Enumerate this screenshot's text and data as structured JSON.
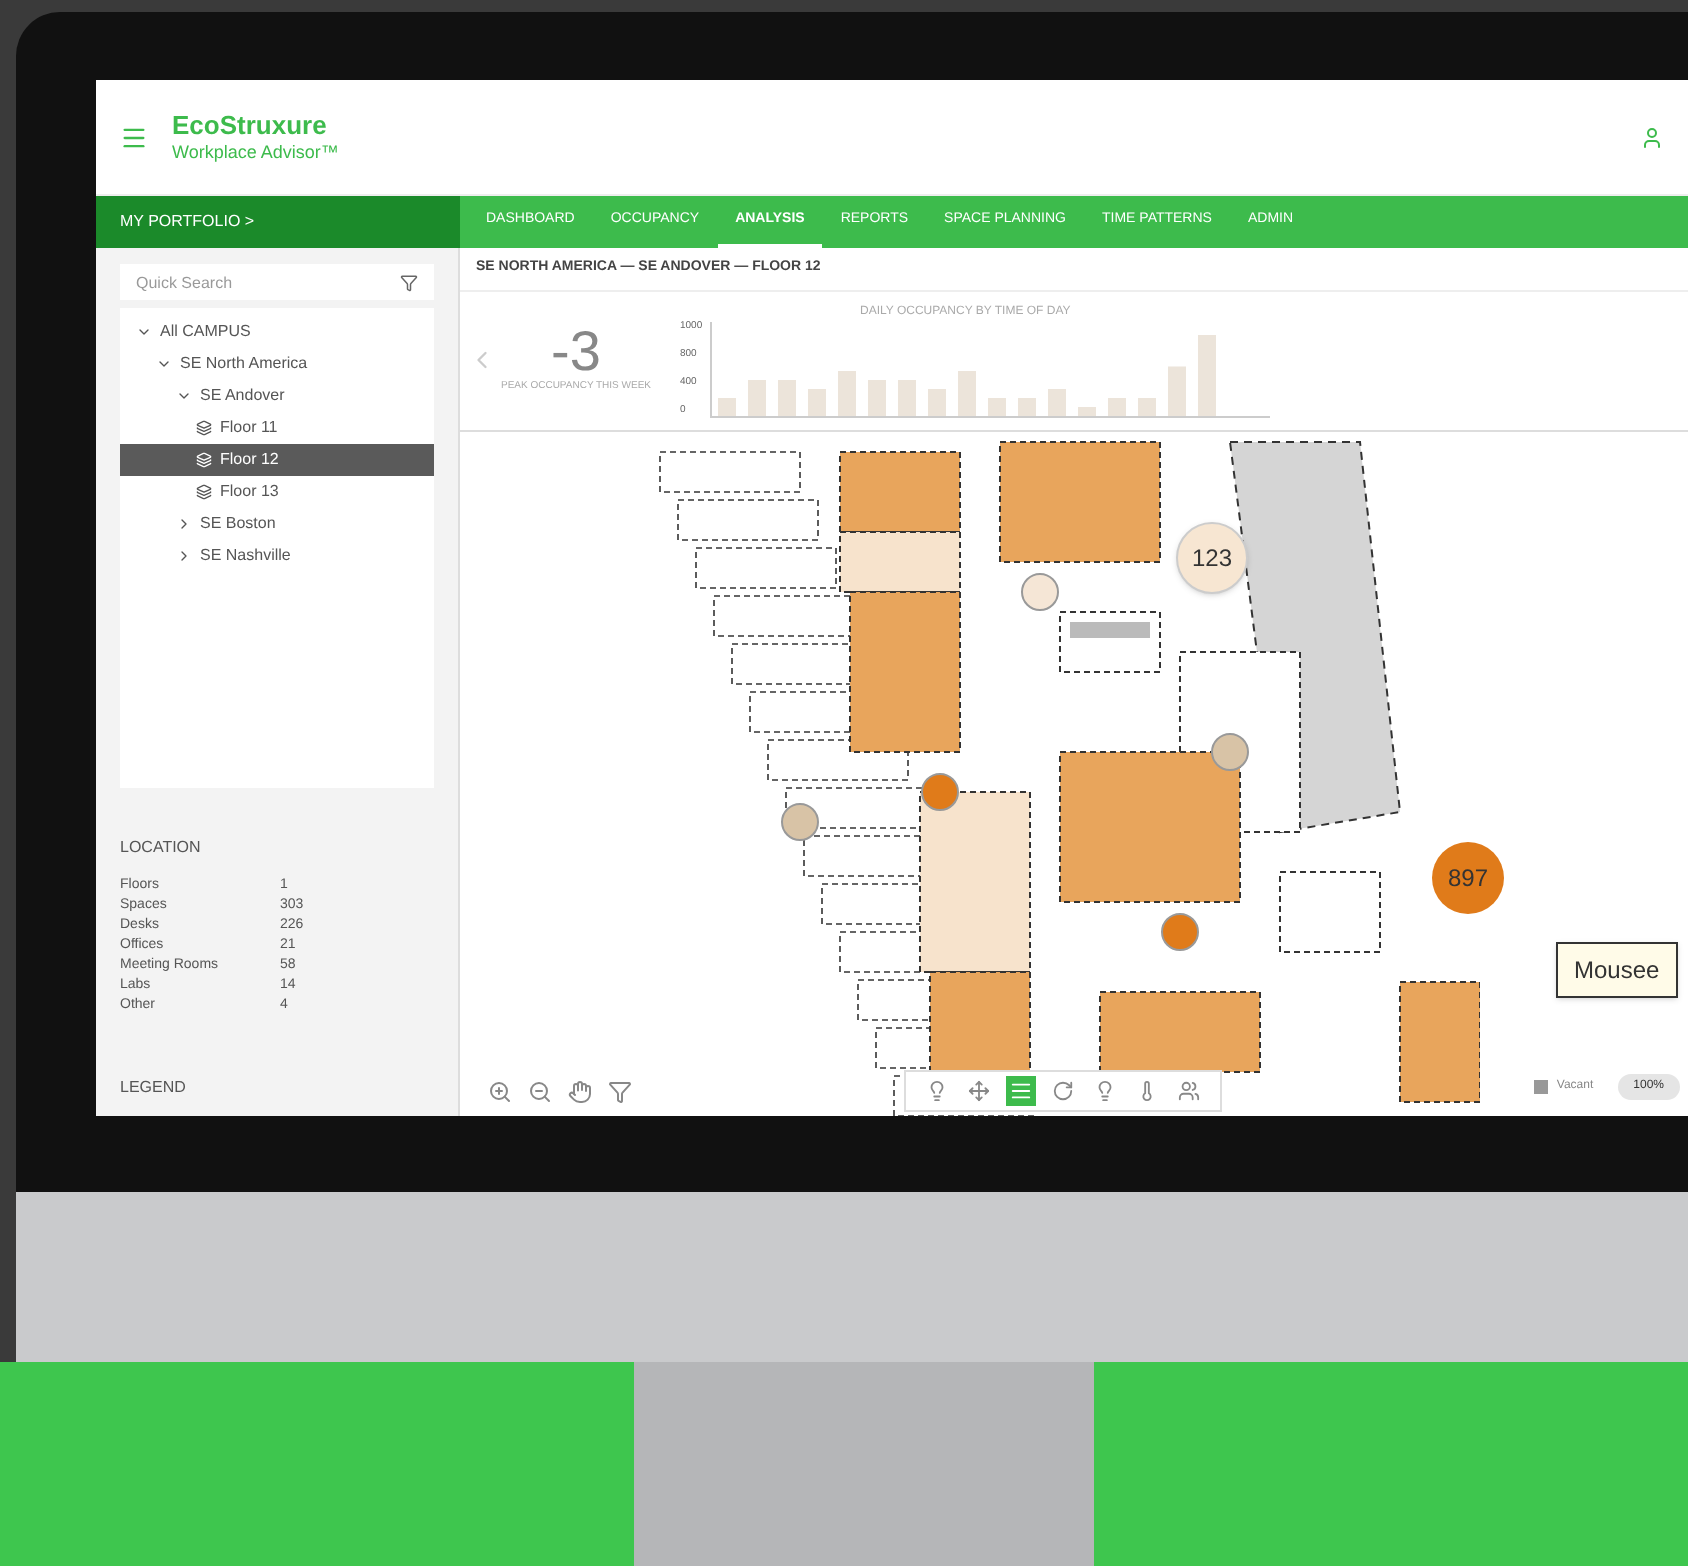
{
  "header": {
    "brand": "EcoStruxure",
    "product": "Workplace Advisor™"
  },
  "portfolio": {
    "label": "MY PORTFOLIO >"
  },
  "tabs": [
    {
      "label": "DASHBOARD",
      "selected": false
    },
    {
      "label": "OCCUPANCY",
      "selected": false
    },
    {
      "label": "ANALYSIS",
      "selected": true
    },
    {
      "label": "REPORTS",
      "selected": false
    },
    {
      "label": "SPACE PLANNING",
      "selected": false
    },
    {
      "label": "TIME PATTERNS",
      "selected": false
    },
    {
      "label": "ADMIN",
      "selected": false
    }
  ],
  "sidebar": {
    "search": {
      "placeholder": "Quick Search"
    },
    "tree": [
      {
        "kind": "group",
        "label": "All CAMPUS",
        "expanded": true,
        "children": [
          {
            "kind": "group",
            "label": "SE North America",
            "expanded": true,
            "children": [
              {
                "kind": "group",
                "label": "SE Andover",
                "expanded": true,
                "children": [
                  {
                    "kind": "floor",
                    "label": "Floor 11",
                    "selected": false
                  },
                  {
                    "kind": "floor",
                    "label": "Floor 12",
                    "selected": true
                  },
                  {
                    "kind": "floor",
                    "label": "Floor 13",
                    "selected": false
                  }
                ]
              },
              {
                "kind": "group",
                "label": "SE Boston",
                "expanded": false
              },
              {
                "kind": "group",
                "label": "SE Nashville",
                "expanded": false
              }
            ]
          }
        ]
      }
    ],
    "details_title": "LOCATION",
    "details": [
      {
        "label": "Floors",
        "value": "1"
      },
      {
        "label": "Spaces",
        "value": "303"
      },
      {
        "label": "Desks",
        "value": "226"
      },
      {
        "label": "Offices",
        "value": "21"
      },
      {
        "label": "Meeting Rooms",
        "value": "58"
      },
      {
        "label": "Labs",
        "value": "14"
      },
      {
        "label": "Other",
        "value": "4"
      }
    ],
    "legend_title": "LEGEND"
  },
  "breadcrumb": "SE NORTH AMERICA — SE ANDOVER — FLOOR 12",
  "summary": {
    "value": "-3",
    "caption": "PEAK OCCUPANCY THIS WEEK"
  },
  "chart": {
    "title": "DAILY OCCUPANCY BY TIME OF DAY",
    "yticks": [
      "1000",
      "800",
      "400",
      "0"
    ]
  },
  "plan": {
    "bubbles": [
      {
        "label": "123",
        "color": "#f7e6d2"
      },
      {
        "label": "897",
        "color": "#e07b1a"
      }
    ],
    "tooltip": "Mousee"
  },
  "tools": [
    {
      "selected": false
    },
    {
      "selected": false
    },
    {
      "selected": true
    },
    {
      "selected": false
    },
    {
      "selected": false
    },
    {
      "selected": false
    },
    {
      "selected": false
    }
  ],
  "legend": {
    "label": "Vacant",
    "zoom": "100%"
  }
}
